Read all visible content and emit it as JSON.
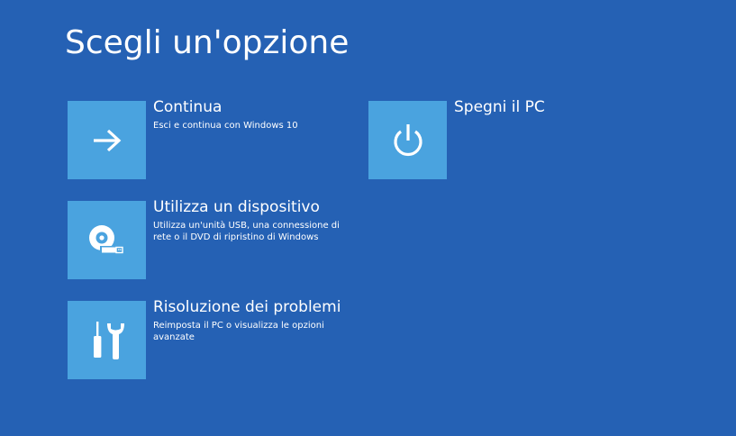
{
  "page": {
    "title": "Scegli un'opzione",
    "background_color": "#2561b4",
    "tile_color": "#4aa3df"
  },
  "options": {
    "continue": {
      "title": "Continua",
      "description": "Esci e continua con Windows 10",
      "icon": "arrow-right-icon"
    },
    "device": {
      "title": "Utilizza un dispositivo",
      "description": "Utilizza un'unità USB, una connessione di rete o il DVD di ripristino di Windows",
      "icon": "disc-usb-icon"
    },
    "troubleshoot": {
      "title": "Risoluzione dei problemi",
      "description": "Reimposta il PC o visualizza le opzioni avanzate",
      "icon": "tools-icon"
    },
    "shutdown": {
      "title": "Spegni il PC",
      "description": "",
      "icon": "power-icon"
    }
  }
}
